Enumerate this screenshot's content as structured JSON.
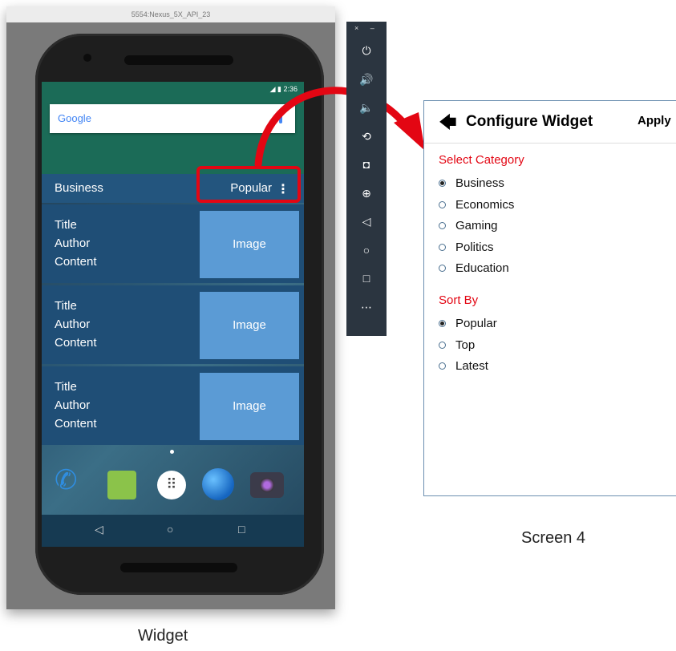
{
  "emulator": {
    "window_title": "5554:Nexus_5X_API_23",
    "window_controls": "×  –",
    "status_time": "2:36"
  },
  "home": {
    "search_brand": "Google"
  },
  "widget": {
    "category": "Business",
    "sort": "Popular",
    "menu_glyph": "⋮",
    "rows": [
      {
        "title": "Title",
        "author": "Author",
        "content": "Content",
        "image": "Image"
      },
      {
        "title": "Title",
        "author": "Author",
        "content": "Content",
        "image": "Image"
      },
      {
        "title": "Title",
        "author": "Author",
        "content": "Content",
        "image": "Image"
      }
    ]
  },
  "navbar": {
    "back": "◁",
    "home": "○",
    "recents": "□"
  },
  "toolbar": {
    "icons": [
      "power-icon",
      "volume-up-icon",
      "volume-down-icon",
      "rotate-icon",
      "camera-icon",
      "zoom-icon",
      "back-icon",
      "home-icon",
      "overview-icon",
      "more-icon"
    ],
    "glyphs": [
      "⏻",
      "🔊",
      "🔈",
      "⟲",
      "◘",
      "⊕",
      "◁",
      "○",
      "□",
      "⋯"
    ]
  },
  "config": {
    "back_glyph": "🡄",
    "title": "Configure Widget",
    "apply": "Apply",
    "category_label": "Select Category",
    "categories": [
      {
        "label": "Business",
        "selected": true
      },
      {
        "label": "Economics",
        "selected": false
      },
      {
        "label": "Gaming",
        "selected": false
      },
      {
        "label": "Politics",
        "selected": false
      },
      {
        "label": "Education",
        "selected": false
      }
    ],
    "sort_label": "Sort By",
    "sorts": [
      {
        "label": "Popular",
        "selected": true
      },
      {
        "label": "Top",
        "selected": false
      },
      {
        "label": "Latest",
        "selected": false
      }
    ]
  },
  "captions": {
    "widget": "Widget",
    "screen": "Screen 4"
  },
  "colors": {
    "highlight": "#e30613",
    "widget_header": "#23557e",
    "image_box": "#5b9bd5"
  }
}
